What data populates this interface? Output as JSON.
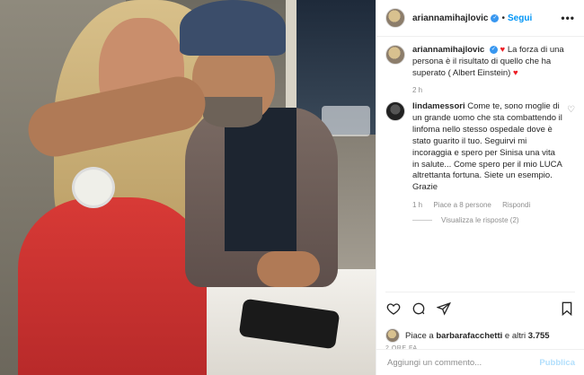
{
  "header": {
    "username": "ariannamihajlovic",
    "verified_icon": "verified-icon",
    "separator": "•",
    "follow_label": "Segui",
    "more_icon": "more-options-icon"
  },
  "caption": {
    "username": "ariannamihajlovic",
    "text": "La forza di una persona è il risultato di quello che ha superato ( Albert Einstein)",
    "time": "2 h"
  },
  "comments": [
    {
      "username": "lindamessori",
      "text": "Come te, sono moglie di un grande uomo che sta combattendo il linfoma nello stesso ospedale dove è stato guarito il tuo. Seguirvi mi incoraggia e spero per Sinisa una vita in salute... Come spero per il mio LUCA altrettanta fortuna. Siete un esempio. Grazie",
      "time": "1 h",
      "likes": "Piace a 8 persone",
      "reply_label": "Rispondi",
      "view_replies": "Visualizza le risposte (2)"
    }
  ],
  "post": {
    "likes_prefix": "Piace a",
    "liked_by": "barbarafacchetti",
    "likes_joiner": "e altri",
    "likes_count": "3.755",
    "time": "2 ORE FA"
  },
  "add_comment": {
    "placeholder": "Aggiungi un commento...",
    "publish_label": "Pubblica"
  },
  "colors": {
    "accent": "#0095f6",
    "heart": "#ed1c24"
  }
}
